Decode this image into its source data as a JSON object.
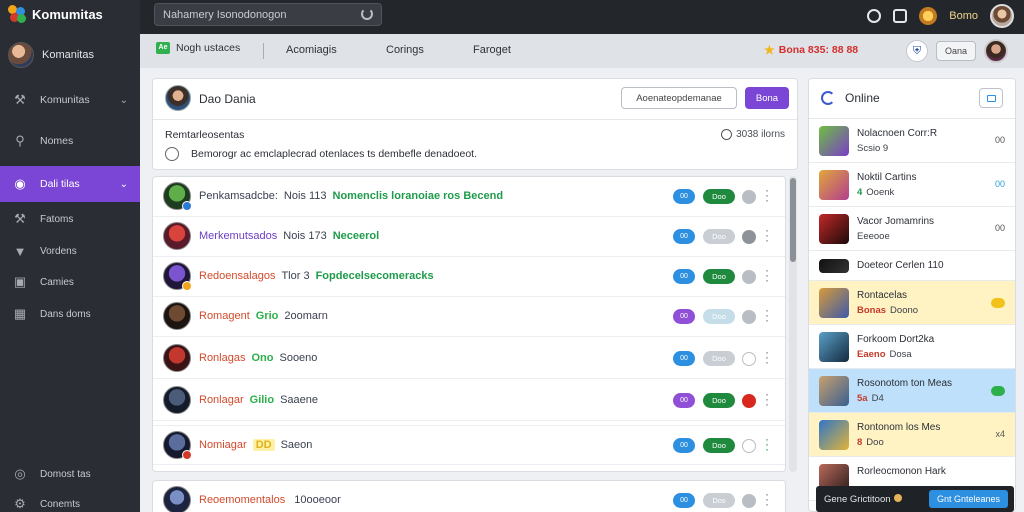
{
  "app": {
    "name": "Komumitas"
  },
  "sidebar": {
    "user": "Komanitas",
    "items": [
      {
        "label": "Komunitas",
        "icon": "hammer-icon",
        "chevron": true
      },
      {
        "label": "Nomes",
        "icon": "search-icon",
        "chevron": false
      },
      {
        "label": "Dali tilas",
        "icon": "globe-icon",
        "chevron": true,
        "active": true
      },
      {
        "label": "Fatoms",
        "icon": "hammer-icon",
        "chevron": false
      },
      {
        "label": "Vordens",
        "icon": "funnel-icon",
        "chevron": false
      },
      {
        "label": "Camies",
        "icon": "image-icon",
        "chevron": false
      },
      {
        "label": "Dans doms",
        "icon": "grid-icon",
        "chevron": false
      }
    ],
    "bottom": [
      {
        "label": "Domost tas",
        "icon": "help-icon"
      },
      {
        "label": "Conemts",
        "icon": "settings-icon"
      }
    ]
  },
  "topbar": {
    "search_value": "Nahamery Isonodonogon",
    "username": "Bomo"
  },
  "tabs": {
    "home": "Nogh ustaces",
    "items": [
      "Acomiagis",
      "Corings",
      "Faroget"
    ],
    "status": "Bona 835: 88 88",
    "button": "Oana"
  },
  "post": {
    "author": "Dao Dania",
    "input_placeholder": "Aoenateopdemanae",
    "button": "Bona",
    "title": "Remtarleosentas",
    "meta": "3038 ilorns",
    "body": "Bemorogr ac emclaplecrad otenlaces ts dembefle denadoeot."
  },
  "rows": [
    {
      "name": "Penkamsadcbe:",
      "name_color": "dark",
      "meta": "Nois 113",
      "extra": "Nomenclis loranoiae ros Becend",
      "pill_a": "00",
      "pill_a_color": "#2d8fe0",
      "pill_b": "Doo",
      "pill_b_color": "#1f8a3e",
      "circ": "grey",
      "avatar_colors": [
        "#5fae4a",
        "#1d3c20"
      ],
      "dot": "#2a7ad8"
    },
    {
      "name": "Merkemutsados",
      "name_color": "purple",
      "meta": "Nois 173",
      "extra": "Neceerol",
      "pill_a": "00",
      "pill_a_color": "#2d8fe0",
      "pill_b": "Doo",
      "pill_b_color": "#c9cdd4",
      "circ": "darkgrey",
      "avatar_colors": [
        "#d8443c",
        "#5a1a2a"
      ],
      "dot": ""
    },
    {
      "name": "Redoensalagos",
      "name_color": "red",
      "meta": "Tlor 3",
      "extra": "Fopdecelsecomeracks",
      "pill_a": "00",
      "pill_a_color": "#2d8fe0",
      "pill_b": "Doo",
      "pill_b_color": "#1f8a3e",
      "circ": "grey",
      "avatar_colors": [
        "#7b55d0",
        "#20163a"
      ],
      "dot": "#f2a51b"
    },
    {
      "name": "Romagent",
      "name_color": "red",
      "tag": "Grio",
      "tag_color": "#2cb04a",
      "meta": "2oomarn",
      "extra": "",
      "pill_a": "00",
      "pill_a_color": "#8f4fd6",
      "pill_b": "Doo",
      "pill_b_color": "#c5dde9",
      "circ": "grey",
      "avatar_colors": [
        "#6e4a32",
        "#1c1410"
      ],
      "dot": ""
    },
    {
      "name": "Ronlagas",
      "name_color": "red",
      "tag": "Ono",
      "tag_color": "#2cb04a",
      "meta": "Sooeno",
      "extra": "",
      "pill_a": "00",
      "pill_a_color": "#2d8fe0",
      "pill_b": "Doo",
      "pill_b_color": "#c9cdd4",
      "circ": "ring",
      "avatar_colors": [
        "#c2382e",
        "#3a1414"
      ],
      "dot": ""
    },
    {
      "name": "Ronlagar",
      "name_color": "red",
      "tag": "Gilio",
      "tag_color": "#2cb04a",
      "meta": "Saaene",
      "extra": "",
      "pill_a": "00",
      "pill_a_color": "#8f4fd6",
      "pill_b": "Doo",
      "pill_b_color": "#1f8a3e",
      "circ": "red",
      "avatar_colors": [
        "#4b5c7a",
        "#141c2c"
      ],
      "dot": ""
    },
    {
      "name": "Nomiagar",
      "name_color": "red",
      "tag": "DD",
      "tag_color": "#e0b21a",
      "meta": "Saeon",
      "extra": "",
      "pill_a": "00",
      "pill_a_color": "#2d8fe0",
      "pill_b": "Doo",
      "pill_b_color": "#1f8a3e",
      "circ": "ring",
      "avatar_colors": [
        "#5b6d9c",
        "#161a2e"
      ],
      "dot": "#d23a2a"
    }
  ],
  "bottom_row": {
    "name": "Reoemomentalos",
    "meta": "10ooeoor",
    "pill_a": "00",
    "pill_b": "Dos"
  },
  "right": {
    "title": "Online",
    "items": [
      {
        "n1": "Nolacnoen Corr:R",
        "n2_tag": "",
        "n2": "Scsio 9",
        "badge": "00",
        "bg": "",
        "avatar_colors": [
          "#6fbf40",
          "#7a3ec8"
        ]
      },
      {
        "n1": "Noktil Cartins",
        "n2_tag": "4",
        "n2": "Ooenk",
        "badge": "00",
        "badge_color": "#2d9fd8",
        "bg": "",
        "avatar_colors": [
          "#e0a83a",
          "#b33d8f"
        ]
      },
      {
        "n1": "Vacor Jomamrins",
        "n2_tag": "",
        "n2": "Eeeooe",
        "badge": "00",
        "bg": "",
        "avatar_colors": [
          "#c22828",
          "#1c0a0a"
        ]
      },
      {
        "n1": "Doeteor Cerlen 110",
        "n2_tag": "",
        "n2": "",
        "badge": "",
        "bg": "",
        "thin": true,
        "avatar_colors": [
          "#111111",
          "#333333"
        ]
      },
      {
        "n1": "Rontacelas",
        "n2_tag": "Bonas",
        "n2": "Doono",
        "badge": "dot-yellow",
        "bg": "yellow",
        "avatar_colors": [
          "#d79b3c",
          "#3d5aa8"
        ]
      },
      {
        "n1": "Forkoom Dort2ka",
        "n2_tag": "Eaeno",
        "n2": "Dosa",
        "badge": "",
        "bg": "",
        "avatar_colors": [
          "#5aa0c8",
          "#142a40"
        ]
      },
      {
        "n1": "Rosonotom ton Meas",
        "n2_tag": "5a",
        "n2": "D4",
        "badge": "dot-green",
        "bg": "blue",
        "avatar_colors": [
          "#c8a070",
          "#3a5f8e"
        ]
      },
      {
        "n1": "Rontonom los Mes",
        "n2_tag": "8",
        "n2": "Doo",
        "badge": "x4",
        "bg": "yellow",
        "avatar_colors": [
          "#2f76c8",
          "#e0b33a"
        ]
      },
      {
        "n1": "Rorleocmonon Hark",
        "n2_tag": "",
        "n2": "",
        "badge": "",
        "bg": "",
        "avatar_colors": [
          "#b86a5a",
          "#2a1a1a"
        ]
      }
    ],
    "bar_text": "Gene Grictitoon",
    "bar_button": "Gnt Gnteleanes"
  }
}
